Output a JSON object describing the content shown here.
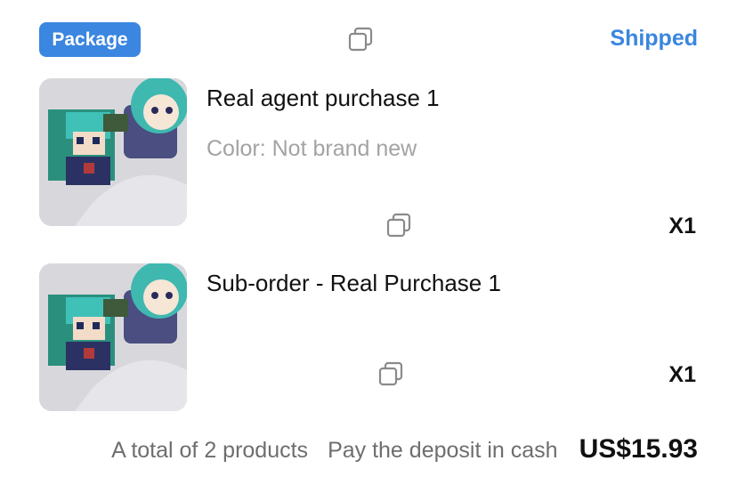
{
  "header": {
    "badge_label": "Package",
    "status": "Shipped"
  },
  "items": [
    {
      "name": "Real agent purchase 1",
      "spec": "Color: Not brand new",
      "quantity": "X1"
    },
    {
      "name": "Sub-order - Real Purchase 1",
      "spec": "",
      "quantity": "X1"
    }
  ],
  "footer": {
    "total_products": "A total of 2 products",
    "payment_method": "Pay the deposit in cash",
    "total_price": "US$15.93"
  },
  "icons": {
    "copy": "copy-icon"
  },
  "colors": {
    "accent": "#3a86e0",
    "muted_text": "#a3a3a3"
  }
}
